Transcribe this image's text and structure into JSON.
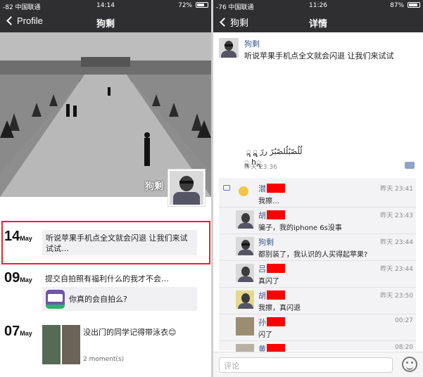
{
  "left": {
    "status": {
      "signal": "-82 中国联通",
      "time": "14:14",
      "battery": "72%",
      "battery_level": 0.72
    },
    "nav": {
      "back_label": "Profile",
      "title": "狗剩"
    },
    "cover": {
      "name": "狗剩"
    },
    "moments": [
      {
        "day": "14",
        "month": "May",
        "text": "听说苹果手机点全文就会闪退 让我们来试试试…"
      },
      {
        "day": "09",
        "month": "May",
        "text": "提交自拍照有福利什么的我才不会…",
        "link_text": "你真的会自拍么?",
        "app_icon": "app-icon"
      },
      {
        "day": "07",
        "month": "May",
        "text": "没出门的同学记得带泳衣😊",
        "count": "2 moment(s)"
      }
    ]
  },
  "right": {
    "status": {
      "signal": "-76 中国联通",
      "time": "11:26",
      "battery": "87%",
      "battery_level": 0.87
    },
    "nav": {
      "back_label": "狗剩",
      "title": "详情"
    },
    "post": {
      "user": "狗剩",
      "text": "听说苹果手机点全文就会闪退 让我们来试试",
      "arabic": "لُلُصّبُلُلصّبُرً ررً ॣ ॣ ॣ ॣh ॣ",
      "time": "昨天 23:36"
    },
    "comments": [
      {
        "name": "潜",
        "text": "我擦…",
        "time": "昨天 23:41"
      },
      {
        "name": "胡",
        "text": "骗子，我的iphone 6s没事",
        "time": "昨天 23:43"
      },
      {
        "name": "狗剩",
        "text": "都别装了，我认识的人买得起苹果?",
        "time": "昨天 23:44"
      },
      {
        "name": "吕",
        "text": "真闪了",
        "time": "昨天 23:44"
      },
      {
        "name": "胡",
        "text": "我擦，真闪退",
        "time": "昨天 23:50"
      },
      {
        "name": "孙",
        "text": "闪了",
        "time": "00:27"
      },
      {
        "name": "黄",
        "text": "",
        "time": "08:20"
      }
    ],
    "input": {
      "placeholder": "评论"
    }
  },
  "colors": {
    "highlight_border": "#e0292d",
    "redaction": "#ff0000",
    "nav_bg": "#2f2f31",
    "username": "#3e5b8c"
  }
}
